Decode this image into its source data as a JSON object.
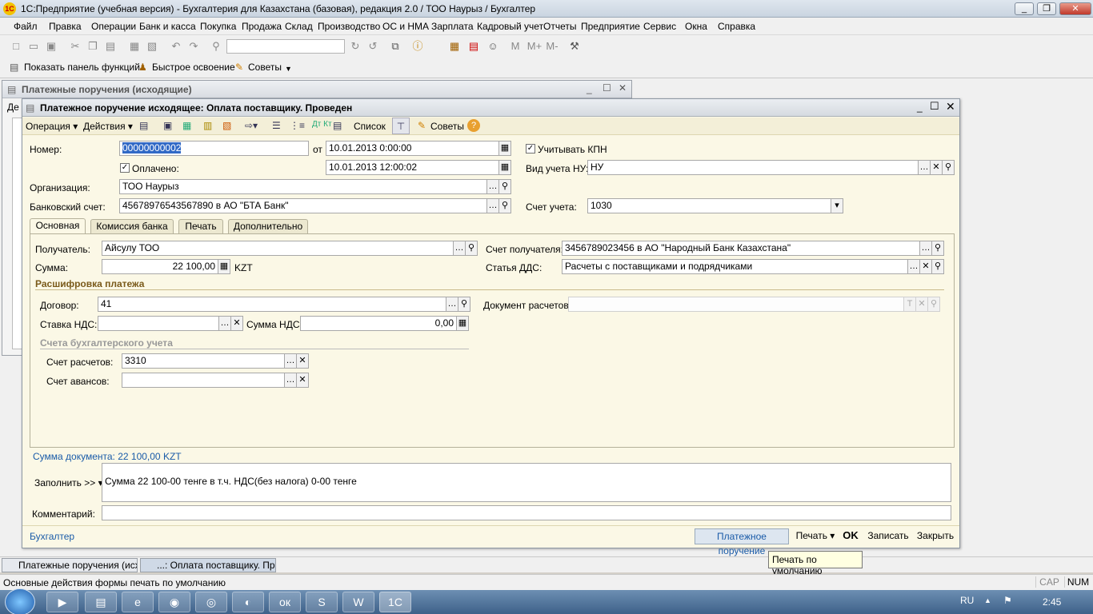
{
  "app": {
    "title": "1С:Предприятие (учебная версия) - Бухгалтерия для Казахстана (базовая), редакция 2.0 / ТОО Наурыз / Бухгалтер",
    "logo": "1С"
  },
  "menu": [
    "Файл",
    "Правка",
    "Операции",
    "Банк и касса",
    "Покупка",
    "Продажа",
    "Склад",
    "Производство",
    "ОС и НМА",
    "Зарплата",
    "Кадровый учет",
    "Отчеты",
    "Предприятие",
    "Сервис",
    "Окна",
    "Справка"
  ],
  "toolbar2": {
    "functions_panel": "Показать панель функций",
    "quick_start": "Быстрое освоение",
    "tips": "Советы"
  },
  "bg_window": {
    "title": "Платежные поручения (исходящие)",
    "col_stub": "Де"
  },
  "doc": {
    "title": "Платежное поручение исходящее: Оплата поставщику. Проведен",
    "toolbar": {
      "operation": "Операция",
      "actions": "Действия",
      "list": "Список",
      "tips": "Советы"
    },
    "number_label": "Номер:",
    "number": "00000000002",
    "from_label": "от",
    "date": "10.01.2013  0:00:00",
    "kpn_label": "Учитывать КПН",
    "paid_label": "Оплачено:",
    "paid_date": "10.01.2013 12:00:02",
    "nu_label": "Вид учета НУ:",
    "nu_value": "НУ",
    "org_label": "Организация:",
    "org_value": "ТОО Наурыз",
    "bank_label": "Банковский счет:",
    "bank_value": "45678976543567890 в АО \"БТА Банк\"",
    "account_label": "Счет учета:",
    "account_value": "1030",
    "tabs": [
      "Основная",
      "Комиссия банка",
      "Печать",
      "Дополнительно"
    ],
    "recipient_label": "Получатель:",
    "recipient_value": "Айсулу ТОО",
    "recipient_acc_label": "Счет получателя:",
    "recipient_acc_value": "3456789023456 в АО \"Народный Банк Казахстана\"",
    "sum_label": "Сумма:",
    "sum_value": "22 100,00",
    "currency": "KZT",
    "dds_label": "Статья ДДС:",
    "dds_value": "Расчеты с поставщиками и подрядчиками",
    "breakdown_title": "Расшифровка платежа",
    "contract_label": "Договор:",
    "contract_value": "41",
    "settle_doc_label": "Документ расчетов:",
    "vat_rate_label": "Ставка НДС:",
    "vat_sum_label": "Сумма НДС:",
    "vat_sum_value": "0,00",
    "accounts_title": "Счета бухгалтерского учета",
    "settle_acc_label": "Счет расчетов:",
    "settle_acc_value": "3310",
    "advance_acc_label": "Счет авансов:",
    "doc_sum_text": "Сумма документа: 22 100,00 KZT",
    "fill_label": "Заполнить >>",
    "purpose_text": "Сумма 22 100-00 тенге в т.ч. НДС(без налога) 0-00 тенге",
    "comment_label": "Комментарий:",
    "responsible": "Бухгалтер",
    "btn_payment_order": "Платежное поручение",
    "btn_print": "Печать",
    "btn_ok": "OK",
    "btn_save": "Записать",
    "btn_close": "Закрыть"
  },
  "tooltip": "Печать по умолчанию",
  "tasks": [
    "Платежные поручения (исх...",
    "...: Оплата поставщику. Пр..."
  ],
  "status_text": "Основные действия формы печать по умолчанию",
  "status_caps": "CAP",
  "status_num": "NUM",
  "tray": {
    "lang": "RU",
    "time": "2:45"
  }
}
